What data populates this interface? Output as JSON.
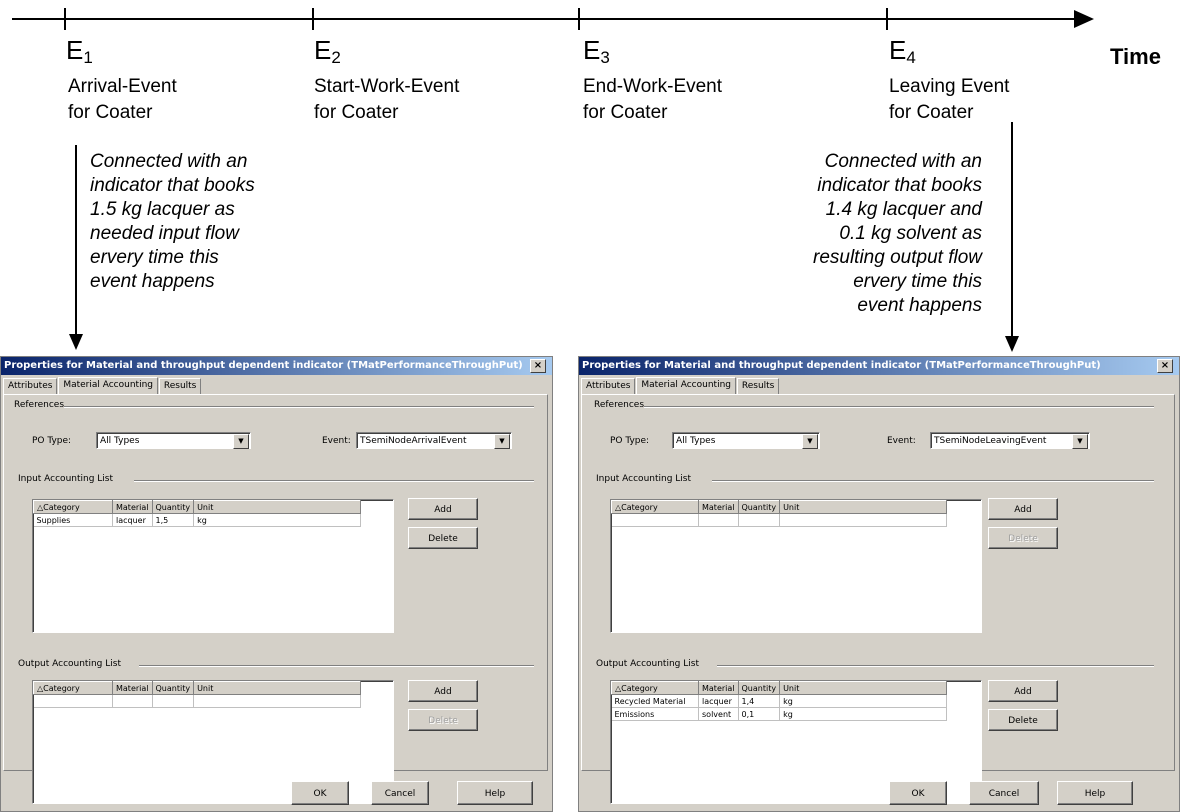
{
  "timeline": {
    "axis_label": "Time",
    "events": [
      {
        "letter": "E",
        "index": "1",
        "line1": "Arrival-Event",
        "line2": "for Coater"
      },
      {
        "letter": "E",
        "index": "2",
        "line1": "Start-Work-Event",
        "line2": "for Coater"
      },
      {
        "letter": "E",
        "index": "3",
        "line1": "End-Work-Event",
        "line2": "for Coater"
      },
      {
        "letter": "E",
        "index": "4",
        "line1": "Leaving Event",
        "line2": "for Coater"
      }
    ],
    "note_left": [
      "Connected with an",
      "indicator that books",
      "1.5 kg lacquer as",
      "needed input flow",
      "ervery time this",
      "event happens"
    ],
    "note_right": [
      "Connected with an",
      "indicator that books",
      "1.4 kg lacquer and",
      "0.1 kg solvent as",
      "resulting output flow",
      "ervery time this",
      "event happens"
    ]
  },
  "dialogs": [
    {
      "title": "Properties for Material and throughput dependent indicator (TMatPerformanceThroughPut)",
      "close": "×",
      "tabs": [
        "Attributes",
        "Material Accounting",
        "Results"
      ],
      "references_label": "References",
      "po_type_label": "PO Type:",
      "po_type_value": "All Types",
      "event_label": "Event:",
      "event_value": "TSemiNodeArrivalEvent",
      "input_label": "Input Accounting List",
      "output_label": "Output Accounting List",
      "columns": [
        "Category",
        "Material",
        "Quantity",
        "Unit"
      ],
      "input_rows": [
        [
          "Supplies",
          "lacquer",
          "1,5",
          "kg"
        ]
      ],
      "output_rows": [],
      "input_add": "Add",
      "input_delete": "Delete",
      "output_add": "Add",
      "output_delete": "Delete",
      "ok": "OK",
      "cancel": "Cancel",
      "help": "Help"
    },
    {
      "title": "Properties for Material and throughput dependent indicator (TMatPerformanceThroughPut)",
      "close": "×",
      "tabs": [
        "Attributes",
        "Material Accounting",
        "Results"
      ],
      "references_label": "References",
      "po_type_label": "PO Type:",
      "po_type_value": "All Types",
      "event_label": "Event:",
      "event_value": "TSemiNodeLeavingEvent",
      "input_label": "Input Accounting List",
      "output_label": "Output Accounting List",
      "columns": [
        "Category",
        "Material",
        "Quantity",
        "Unit"
      ],
      "input_rows": [],
      "output_rows": [
        [
          "Recycled Material",
          "lacquer",
          "1,4",
          "kg"
        ],
        [
          "Emissions",
          "solvent",
          "0,1",
          "kg"
        ]
      ],
      "input_add": "Add",
      "input_delete": "Delete",
      "output_add": "Add",
      "output_delete": "Delete",
      "ok": "OK",
      "cancel": "Cancel",
      "help": "Help"
    }
  ]
}
